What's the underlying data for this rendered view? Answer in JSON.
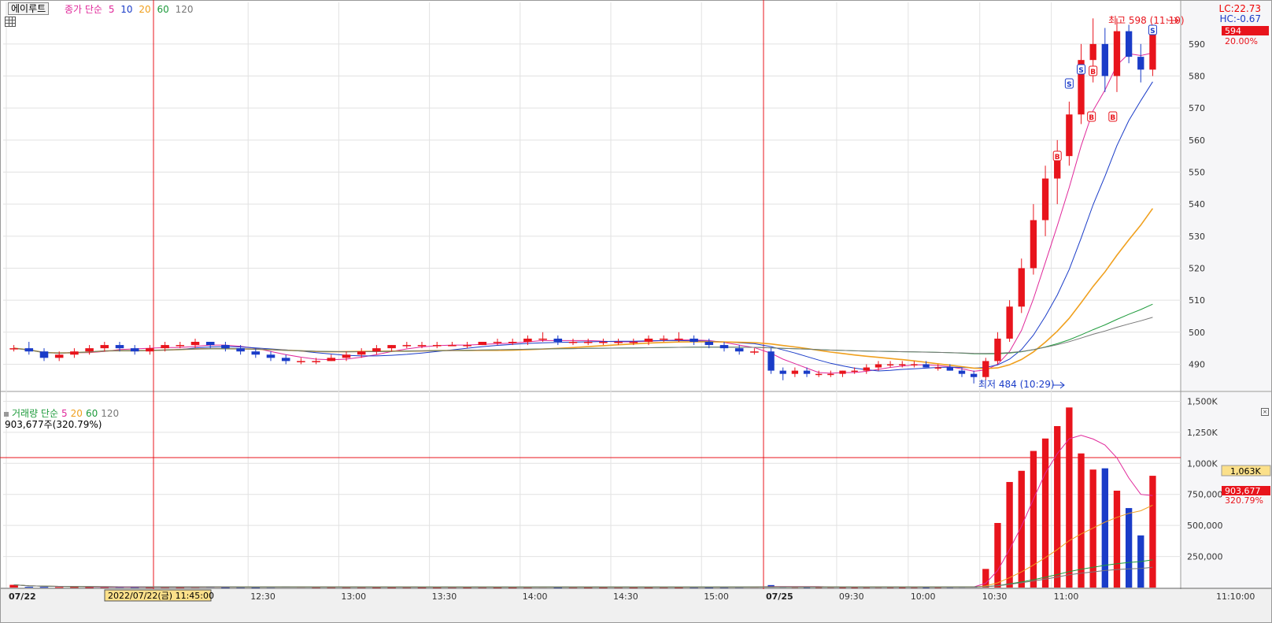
{
  "header": {
    "stock_name": "에이루트",
    "price_legend": {
      "label": "종가 단순",
      "periods": [
        "5",
        "10",
        "20",
        "60",
        "120"
      ]
    },
    "lc": "LC:22.73",
    "hc": "HC:-0.67"
  },
  "volume_header": {
    "legend": {
      "label": "거래량 단순",
      "periods": [
        "5",
        "20",
        "60",
        "120"
      ]
    },
    "current": "903,677주(320.79%)"
  },
  "colors": {
    "up": "#e8141c",
    "down": "#1a3cc8",
    "ma5": "#e0289a",
    "ma10": "#1a3cc8",
    "ma20": "#f0a01e",
    "ma60": "#1e9b3c",
    "ma120": "#777777",
    "crosshair": "#e8141c"
  },
  "annotations": {
    "high": "최고 598 (11:10)",
    "low": "최저 484 (10:29)",
    "current_price": "594",
    "current_change": "20.00%",
    "crosshair_volume": "1,063K",
    "current_volume": "903,677",
    "current_volume_pct": "320.79%",
    "crosshair_date": "2022/07/22(금) 11:45:00",
    "bottom_right_time": "11:10:00",
    "signals": [
      "S",
      "B",
      "S",
      "B",
      "B",
      "B",
      "S"
    ]
  },
  "chart_data": [
    {
      "type": "candlestick",
      "title": "",
      "x_tick_labels": [
        "07/22",
        "12:30",
        "13:00",
        "13:30",
        "14:00",
        "14:30",
        "15:00",
        "07/25",
        "09:30",
        "10:00",
        "10:30",
        "11:00"
      ],
      "y_tick_labels": [
        "490",
        "500",
        "510",
        "520",
        "530",
        "540",
        "550",
        "560",
        "570",
        "580",
        "590"
      ],
      "ylim": [
        482,
        603
      ],
      "segments": [
        {
          "start": "07/22 11:10",
          "price": [
            [
              495,
              496,
              494,
              495
            ],
            [
              495,
              497,
              493,
              494
            ],
            [
              494,
              495,
              491,
              492
            ],
            [
              492,
              494,
              491,
              493
            ],
            [
              493,
              495,
              492,
              494
            ],
            [
              494,
              496,
              493,
              495
            ],
            [
              495,
              497,
              494,
              496
            ],
            [
              496,
              497,
              494,
              495
            ],
            [
              495,
              496,
              493,
              494
            ],
            [
              494,
              496,
              493,
              495
            ],
            [
              495,
              497,
              494,
              496
            ],
            [
              496,
              497,
              495,
              496
            ],
            [
              496,
              498,
              495,
              497
            ],
            [
              497,
              497,
              495,
              496
            ],
            [
              496,
              497,
              494,
              495
            ],
            [
              495,
              496,
              493,
              494
            ],
            [
              494,
              495,
              492,
              493
            ],
            [
              493,
              494,
              491,
              492
            ],
            [
              492,
              493,
              490,
              491
            ],
            [
              491,
              492,
              490,
              491
            ],
            [
              491,
              492,
              490,
              491
            ],
            [
              491,
              493,
              491,
              492
            ],
            [
              492,
              494,
              491,
              493
            ],
            [
              493,
              495,
              492,
              494
            ],
            [
              494,
              496,
              493,
              495
            ],
            [
              495,
              496,
              494,
              496
            ],
            [
              496,
              497,
              495,
              496
            ],
            [
              496,
              497,
              495,
              496
            ],
            [
              496,
              497,
              495,
              496
            ],
            [
              496,
              497,
              496,
              496
            ],
            [
              496,
              497,
              495,
              496
            ],
            [
              496,
              497,
              496,
              497
            ],
            [
              497,
              498,
              496,
              497
            ],
            [
              497,
              498,
              496,
              497
            ],
            [
              497,
              499,
              496,
              498
            ],
            [
              498,
              500,
              497,
              498
            ],
            [
              498,
              499,
              496,
              497
            ],
            [
              497,
              498,
              496,
              497
            ],
            [
              497,
              498,
              496,
              497
            ],
            [
              497,
              498,
              496,
              497
            ],
            [
              497,
              498,
              496,
              497
            ],
            [
              497,
              498,
              496,
              497
            ],
            [
              497,
              499,
              496,
              498
            ],
            [
              498,
              499,
              497,
              498
            ],
            [
              498,
              500,
              497,
              498
            ],
            [
              498,
              499,
              496,
              497
            ],
            [
              497,
              498,
              495,
              496
            ],
            [
              496,
              497,
              494,
              495
            ],
            [
              495,
              496,
              493,
              494
            ],
            [
              494,
              495,
              493,
              494
            ]
          ]
        },
        {
          "start": "07/25 09:00",
          "price": [
            [
              494,
              495,
              487,
              488
            ],
            [
              488,
              489,
              485,
              487
            ],
            [
              487,
              489,
              486,
              488
            ],
            [
              488,
              489,
              486,
              487
            ],
            [
              487,
              488,
              486,
              487
            ],
            [
              487,
              488,
              486,
              487
            ],
            [
              487,
              488,
              486,
              488
            ],
            [
              488,
              489,
              487,
              488
            ],
            [
              488,
              490,
              487,
              489
            ],
            [
              489,
              491,
              488,
              490
            ],
            [
              490,
              491,
              489,
              490
            ],
            [
              490,
              491,
              489,
              490
            ],
            [
              490,
              491,
              489,
              490
            ],
            [
              490,
              491,
              489,
              489
            ],
            [
              489,
              490,
              488,
              489
            ],
            [
              489,
              490,
              488,
              488
            ],
            [
              488,
              489,
              486,
              487
            ],
            [
              487,
              488,
              484,
              486
            ],
            [
              486,
              492,
              485,
              491
            ],
            [
              491,
              500,
              490,
              498
            ],
            [
              498,
              510,
              497,
              508
            ],
            [
              508,
              523,
              506,
              520
            ],
            [
              520,
              540,
              518,
              535
            ],
            [
              535,
              552,
              530,
              548
            ],
            [
              548,
              560,
              540,
              555
            ],
            [
              555,
              572,
              552,
              568
            ],
            [
              568,
              590,
              565,
              585
            ],
            [
              585,
              598,
              578,
              590
            ],
            [
              590,
              595,
              575,
              580
            ],
            [
              580,
              598,
              575,
              594
            ],
            [
              594,
              596,
              584,
              586
            ],
            [
              586,
              590,
              578,
              582
            ],
            [
              582,
              596,
              580,
              594
            ]
          ]
        }
      ]
    },
    {
      "type": "bar",
      "title": "",
      "y_tick_labels": [
        "250,000",
        "500,000",
        "750,000",
        "1,000K",
        "1,250K",
        "1,500K"
      ],
      "ylim": [
        0,
        1560000
      ],
      "segments": [
        {
          "start": "07/22 11:10",
          "volume": [
            22000,
            6000,
            5000,
            4000,
            4000,
            3000,
            4000,
            5000,
            4000,
            3000,
            4000,
            3000,
            5000,
            6000,
            3000,
            4000,
            3000,
            5000,
            8000,
            6000,
            4000,
            4000,
            4000,
            4000,
            3000,
            3000,
            4000,
            3000,
            3000,
            4000,
            3000,
            4000,
            3000,
            3000,
            4000,
            6000,
            3000,
            4000,
            3000,
            3000,
            4000,
            3000,
            3000,
            4000,
            3000,
            4000,
            3000,
            4000,
            5000,
            6000
          ]
        },
        {
          "start": "07/25 09:00",
          "volume": [
            20000,
            6000,
            5000,
            4000,
            4000,
            5000,
            3000,
            3000,
            4000,
            5000,
            4000,
            3000,
            4000,
            3000,
            4000,
            5000,
            6000,
            8000,
            150000,
            520000,
            850000,
            940000,
            1100000,
            1200000,
            1300000,
            1450000,
            1080000,
            950000,
            960000,
            780000,
            640000,
            420000,
            900000
          ]
        }
      ]
    }
  ]
}
